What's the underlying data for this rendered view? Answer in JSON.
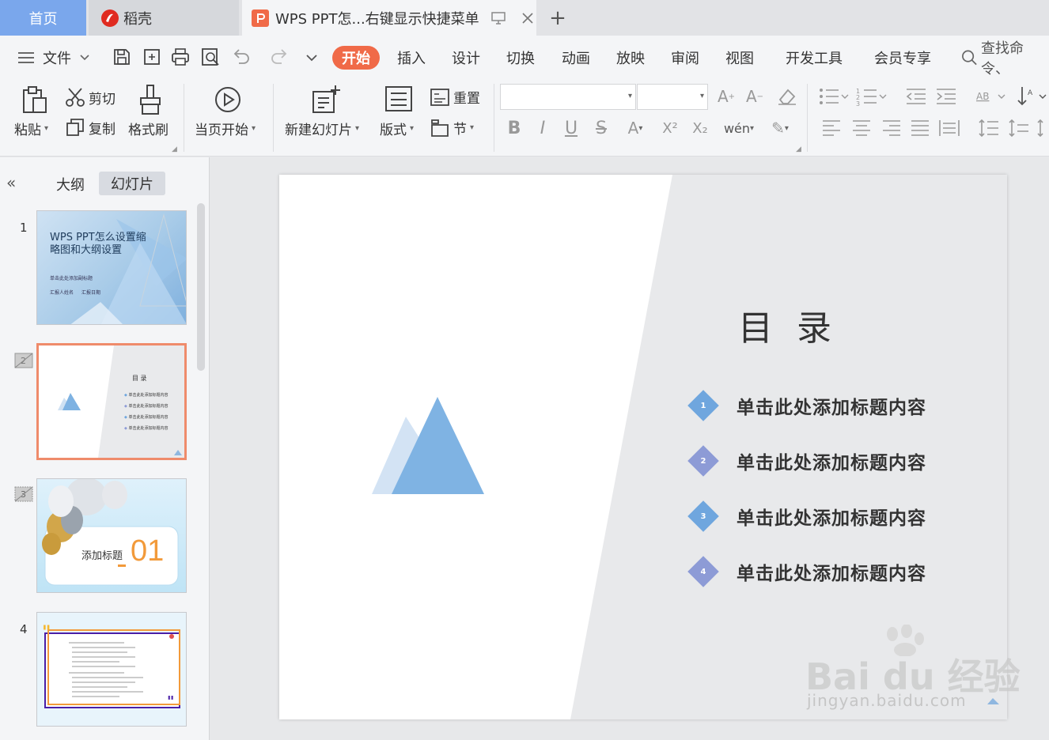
{
  "tabs": {
    "home": "首页",
    "daoke": "稻壳",
    "document": "WPS PPT怎...右键显示快捷菜单",
    "add": "+"
  },
  "menu": {
    "file": "文件",
    "items": [
      "开始",
      "插入",
      "设计",
      "切换",
      "动画",
      "放映",
      "审阅",
      "视图",
      "开发工具",
      "会员专享"
    ],
    "search": "查找命令、"
  },
  "ribbon": {
    "paste": "粘贴",
    "cut": "剪切",
    "copy": "复制",
    "format_painter": "格式刷",
    "from_current": "当页开始",
    "new_slide": "新建幻灯片",
    "layout": "版式",
    "reset": "重置",
    "section": "节"
  },
  "panel": {
    "outline_tab": "大纲",
    "slides_tab": "幻灯片",
    "numbers": [
      "1",
      "2",
      "3",
      "4"
    ],
    "slide1": {
      "title": "WPS PPT怎么设置缩略图和大纲设置",
      "subtitle": "单击此处添加副标题",
      "reporter": "汇报人姓名",
      "date": "汇报日期"
    },
    "slide2": {
      "title": "目 录",
      "items": [
        "单击此处添加标题内容",
        "单击此处添加标题内容",
        "单击此处添加标题内容",
        "单击此处添加标题内容"
      ]
    },
    "slide3": {
      "title": "添加标题",
      "number": "01"
    }
  },
  "slide": {
    "title": "目 录",
    "items": [
      {
        "num": "1",
        "label": "单击此处添加标题内容"
      },
      {
        "num": "2",
        "label": "单击此处添加标题内容"
      },
      {
        "num": "3",
        "label": "单击此处添加标题内容"
      },
      {
        "num": "4",
        "label": "单击此处添加标题内容"
      }
    ]
  },
  "watermark": {
    "brand": "Bai du 经验",
    "url": "jingyan.baidu.com"
  },
  "colors": {
    "accent": "#f06a48",
    "home_tab": "#7aa7ec",
    "diamond_blue": "#6fa6de",
    "diamond_purple": "#8d9bd6",
    "selected_border": "#ef8b6b"
  }
}
